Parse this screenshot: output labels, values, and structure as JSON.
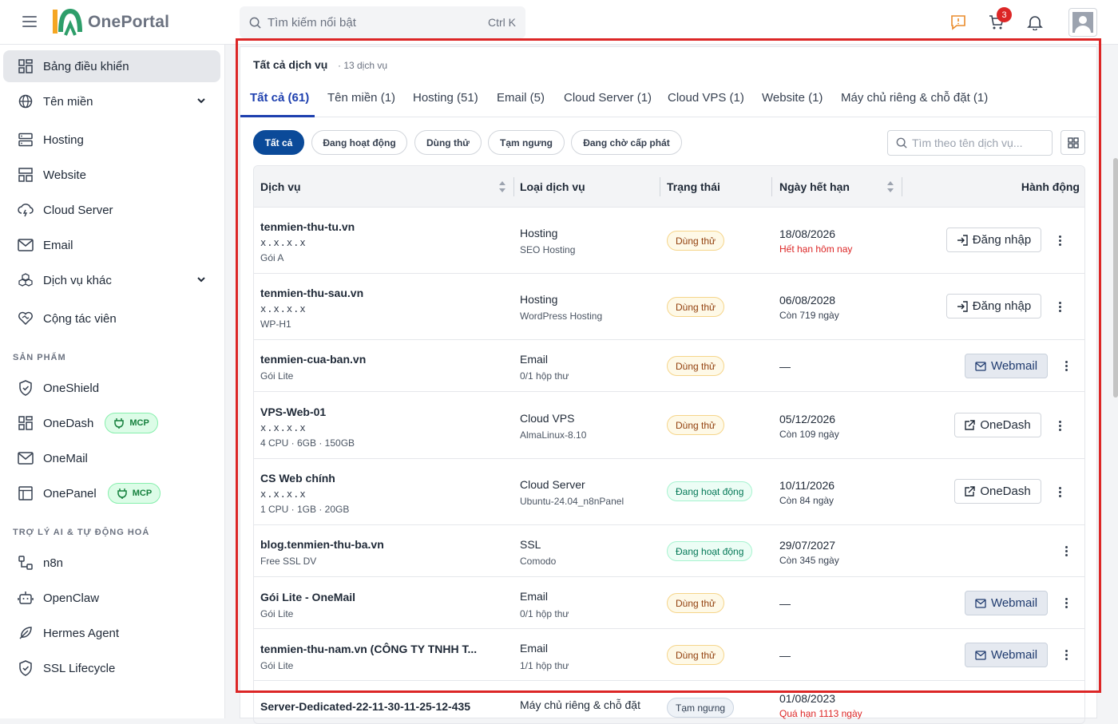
{
  "app": {
    "name": "OnePortal"
  },
  "search": {
    "placeholder": "Tìm kiếm nổi bật",
    "shortcut": "Ctrl K"
  },
  "header": {
    "cart_count": "3"
  },
  "sidebar": {
    "items": [
      {
        "label": "Bảng điều khiển"
      },
      {
        "label": "Tên miền"
      },
      {
        "label": "Hosting"
      },
      {
        "label": "Website"
      },
      {
        "label": "Cloud Server"
      },
      {
        "label": "Email"
      },
      {
        "label": "Dịch vụ khác"
      },
      {
        "label": "Cộng tác viên"
      }
    ],
    "section_products": "SẢN PHẨM",
    "products": [
      {
        "label": "OneShield"
      },
      {
        "label": "OneDash",
        "badge": "MCP"
      },
      {
        "label": "OneMail"
      },
      {
        "label": "OnePanel",
        "badge": "MCP"
      }
    ],
    "section_ai": "TRỢ LÝ AI & TỰ ĐỘNG HOÁ",
    "ai": [
      {
        "label": "n8n"
      },
      {
        "label": "OpenClaw"
      },
      {
        "label": "Hermes Agent"
      },
      {
        "label": "SSL Lifecycle"
      }
    ]
  },
  "panel": {
    "title": "Tất cả dịch vụ",
    "count": "· 13 dịch vụ",
    "tabs": [
      {
        "label": "Tất cả (61)"
      },
      {
        "label": "Tên miền (1)"
      },
      {
        "label": "Hosting (51)"
      },
      {
        "label": "Email (5)"
      },
      {
        "label": "Cloud Server (1)"
      },
      {
        "label": "Cloud VPS (1)"
      },
      {
        "label": "Website (1)"
      },
      {
        "label": "Máy chủ riêng & chỗ đặt (1)"
      }
    ],
    "filters": [
      {
        "label": "Tất cả"
      },
      {
        "label": "Đang hoạt động"
      },
      {
        "label": "Dùng thử"
      },
      {
        "label": "Tạm ngưng"
      },
      {
        "label": "Đang chờ cấp phát"
      }
    ],
    "service_search_placeholder": "Tìm theo tên dịch vụ...",
    "columns": {
      "service": "Dịch vụ",
      "type": "Loại dịch vụ",
      "status": "Trạng thái",
      "expiry": "Ngày hết hạn",
      "action": "Hành động"
    },
    "rows": [
      {
        "name": "tenmien-thu-tu.vn",
        "ip": "x.x.x.x",
        "plan": "Gói A",
        "type": "Hosting",
        "type_sub": "SEO Hosting",
        "status": "Dùng thử",
        "date": "18/08/2026",
        "remain": "Hết hạn hôm nay",
        "action": "Đăng nhập"
      },
      {
        "name": "tenmien-thu-sau.vn",
        "ip": "x.x.x.x",
        "plan": "WP-H1",
        "type": "Hosting",
        "type_sub": "WordPress Hosting",
        "status": "Dùng thử",
        "date": "06/08/2028",
        "remain": "Còn 719 ngày",
        "action": "Đăng nhập"
      },
      {
        "name": "tenmien-cua-ban.vn",
        "plan": "Gói Lite",
        "type": "Email",
        "type_sub": "0/1 hộp thư",
        "status": "Dùng thử",
        "date": "—",
        "action": "Webmail"
      },
      {
        "name": "VPS-Web-01",
        "ip": "x.x.x.x",
        "plan": "4 CPU · 6GB · 150GB",
        "type": "Cloud VPS",
        "type_sub": "AlmaLinux-8.10",
        "status": "Dùng thử",
        "date": "05/12/2026",
        "remain": "Còn 109 ngày",
        "action": "OneDash"
      },
      {
        "name": "CS Web chính",
        "ip": "x.x.x.x",
        "plan": "1 CPU · 1GB · 20GB",
        "type": "Cloud Server",
        "type_sub": "Ubuntu-24.04_n8nPanel",
        "status": "Đang hoạt động",
        "date": "10/11/2026",
        "remain": "Còn 84 ngày",
        "action": "OneDash"
      },
      {
        "name": "blog.tenmien-thu-ba.vn",
        "plan": "Free SSL DV",
        "type": "SSL",
        "type_sub": "Comodo",
        "status": "Đang hoạt động",
        "date": "29/07/2027",
        "remain": "Còn 345 ngày"
      },
      {
        "name": "Gói Lite - OneMail",
        "plan": "Gói Lite",
        "type": "Email",
        "type_sub": "0/1 hộp thư",
        "status": "Dùng thử",
        "date": "—",
        "action": "Webmail"
      },
      {
        "name": "tenmien-thu-nam.vn (CÔNG TY TNHH T...",
        "plan": "Gói Lite",
        "type": "Email",
        "type_sub": "1/1 hộp thư",
        "status": "Dùng thử",
        "date": "—",
        "action": "Webmail"
      },
      {
        "name": "Server-Dedicated-22-11-30-11-25-12-435",
        "type": "Máy chủ riêng & chỗ đặt",
        "status": "Tạm ngưng",
        "date": "01/08/2023",
        "remain": "Quá hạn 1113 ngày"
      }
    ]
  }
}
